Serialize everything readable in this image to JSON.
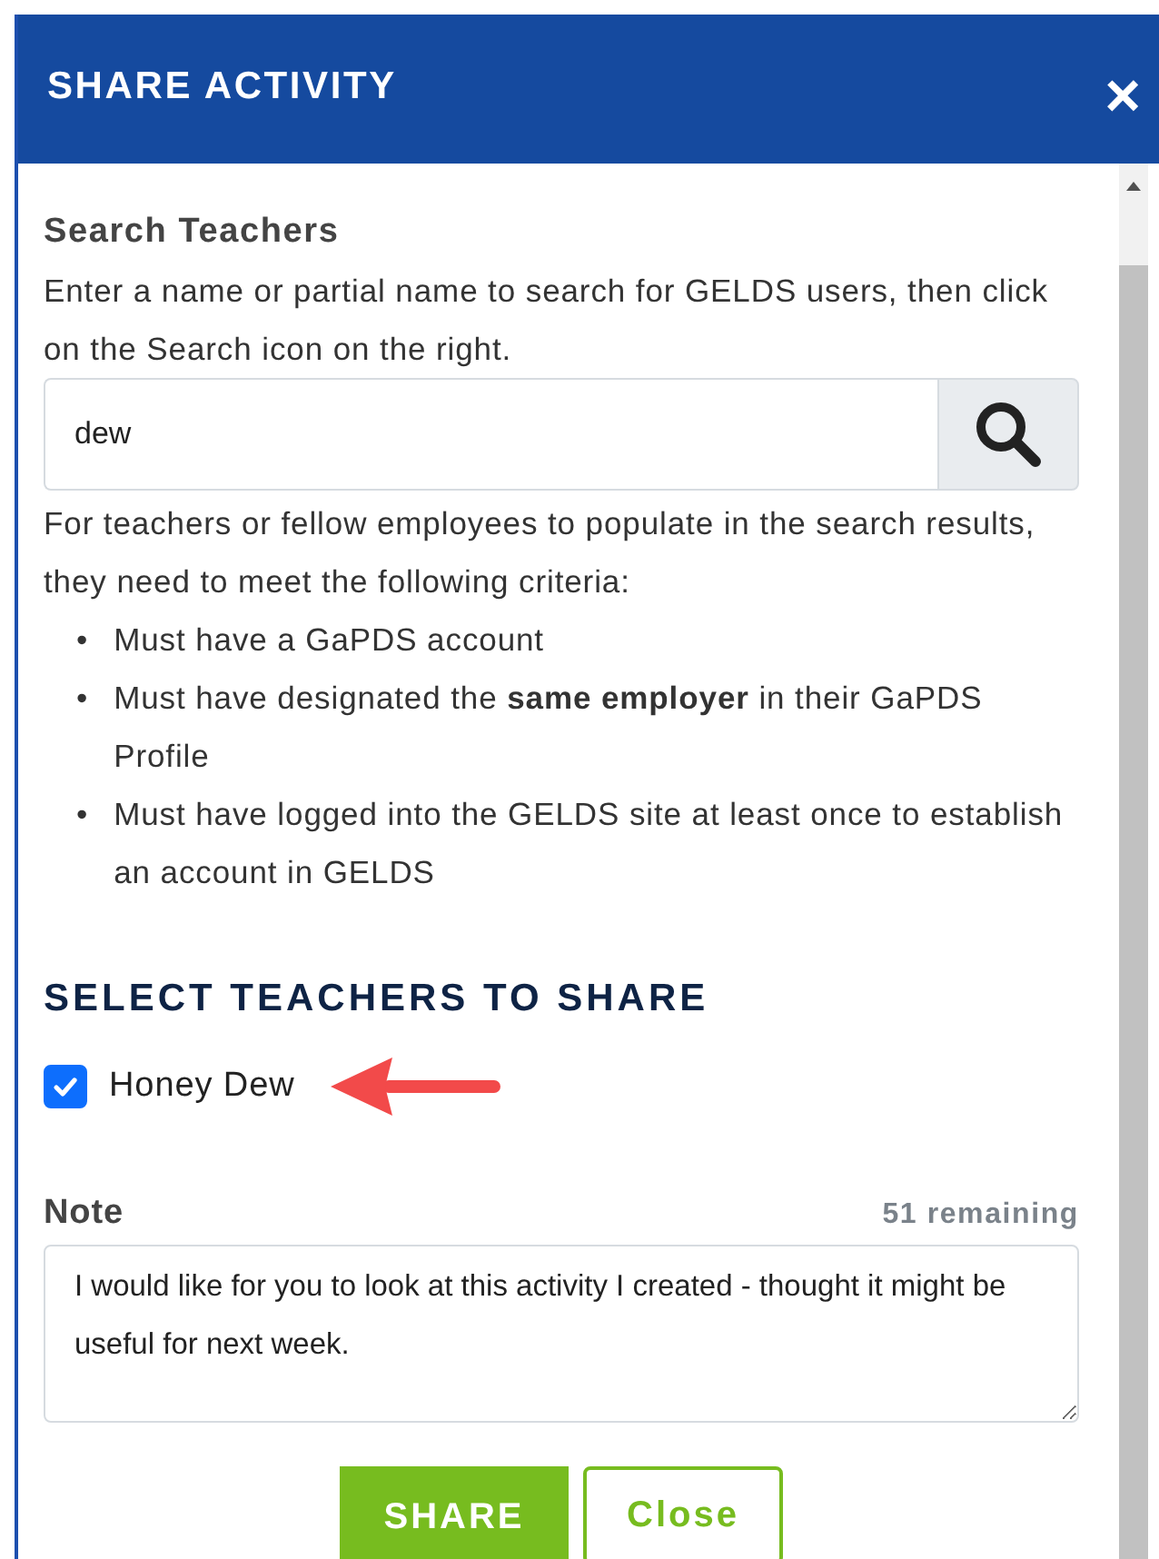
{
  "dialog": {
    "title": "SHARE ACTIVITY",
    "close_glyph": "×"
  },
  "search": {
    "heading": "Search Teachers",
    "instructions": "Enter a name or partial name to search for GELDS users, then click on the Search icon on the right.",
    "value": "dew"
  },
  "criteria": {
    "intro": "For teachers or fellow employees to populate in the search results, they need to meet the following criteria:",
    "items": [
      {
        "bullet": "•",
        "text": "Must have a GaPDS account"
      },
      {
        "bullet": "•",
        "text": "Must have designated the **same employer** in their GaPDS Profile"
      },
      {
        "bullet": "•",
        "text": "Must have logged into the GELDS site at least once to establish an account in GELDS"
      }
    ]
  },
  "select": {
    "heading": "SELECT TEACHERS TO SHARE",
    "teachers": [
      {
        "name": "Honey Dew",
        "checked": true,
        "annotated": true
      }
    ]
  },
  "note": {
    "label": "Note",
    "remaining": "51 remaining",
    "value": "I would like for you to look at this activity I created - thought it might be useful for next week."
  },
  "buttons": [
    {
      "label": "SHARE",
      "kind": "primary"
    },
    {
      "label": "Close",
      "kind": "outline"
    }
  ]
}
